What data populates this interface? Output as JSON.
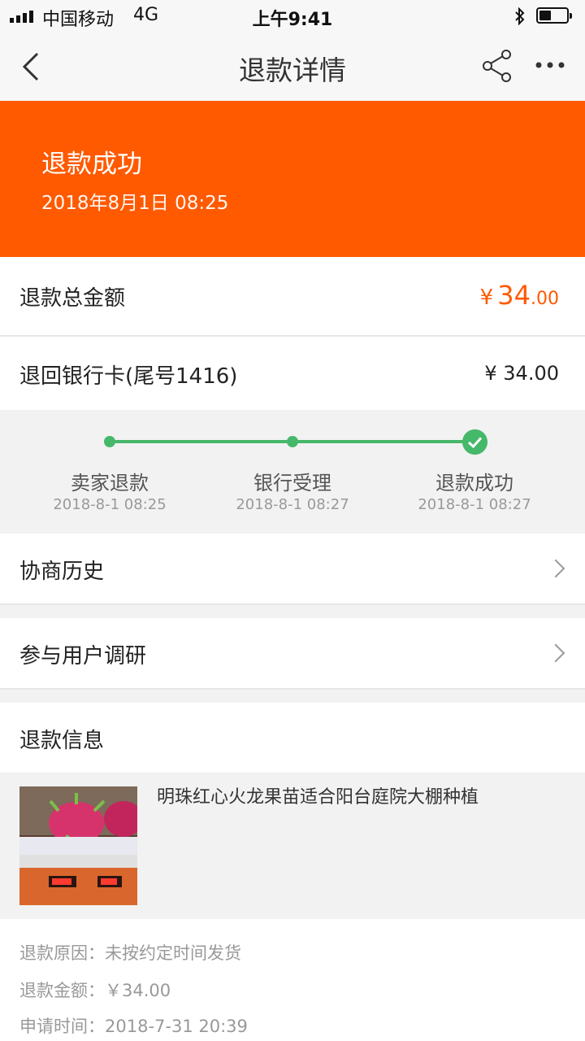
{
  "status_bar": {
    "carrier": "中国移动",
    "network": "4G",
    "time": "上午9:41"
  },
  "nav": {
    "title": "退款详情",
    "back_icon": "chevron-left-icon",
    "share_icon": "share-icon",
    "more_icon": "more-icon"
  },
  "hero": {
    "status": "退款成功",
    "time": "2018年8月1日 08:25",
    "color": "#ff5a00"
  },
  "refund_total": {
    "label": "退款总金额",
    "currency": "¥",
    "amount_int": "34",
    "amount_dec": ".00",
    "color": "#ff5a00"
  },
  "refund_card": {
    "label": "退回银行卡(尾号1416)",
    "amount": "¥ 34.00"
  },
  "progress": {
    "color": "#46b86a",
    "steps": [
      {
        "label": "卖家退款",
        "time": "2018-8-1 08:25"
      },
      {
        "label": "银行受理",
        "time": "2018-8-1 08:27"
      },
      {
        "label": "退款成功",
        "time": "2018-8-1 08:27"
      }
    ]
  },
  "links": {
    "history": "协商历史",
    "survey": "参与用户调研"
  },
  "refund_info": {
    "section_title": "退款信息",
    "product_title": "明珠红心火龙果苗适合阳台庭院大棚种植",
    "reason": "退款原因：未按约定时间发货",
    "amount": "退款金额：￥34.00",
    "apply_time": "申请时间：2018-7-31 20:39"
  }
}
